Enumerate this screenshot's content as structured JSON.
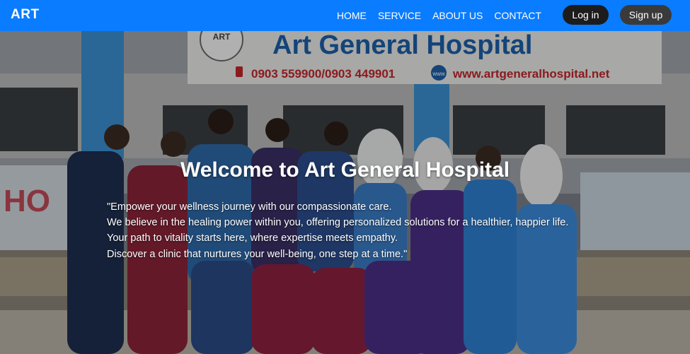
{
  "brand": "ART",
  "nav": {
    "links": [
      "HOME",
      "SERVICE",
      "ABOUT US",
      "CONTACT"
    ],
    "login": "Log in",
    "signup": "Sign up"
  },
  "hero": {
    "title": "Welcome to Art General Hospital",
    "lines": [
      "\"Empower your wellness journey with our compassionate care.",
      "We believe in the healing power within you, offering personalized solutions for a healthier, happier life.",
      "Your path to vitality starts here, where expertise meets empathy.",
      "Discover a clinic that nurtures your well-being, one step at a time.\""
    ],
    "sign": {
      "logo_text": "ART",
      "name": "Art General Hospital",
      "phone": "0903 559900/0903 449901",
      "web_badge": "www",
      "url": "www.artgeneralhospital.net"
    },
    "wall_text": "HO"
  }
}
